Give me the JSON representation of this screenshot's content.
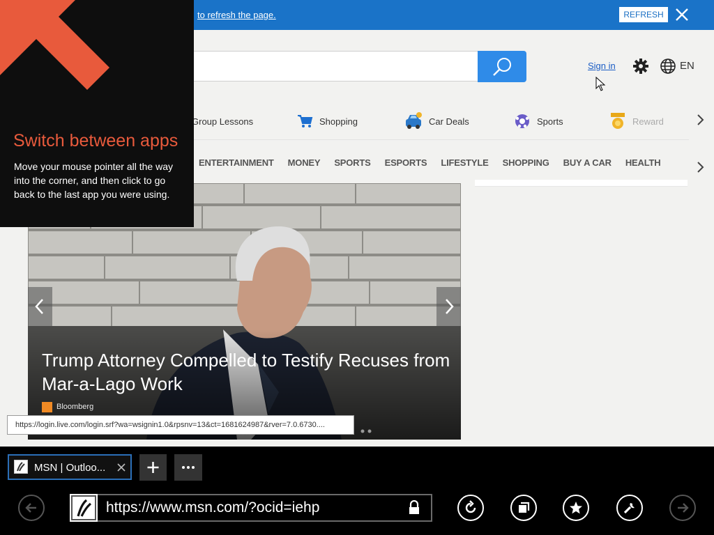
{
  "banner": {
    "text": "to refresh the page.",
    "refresh_label": "REFRESH"
  },
  "header": {
    "sign_in": "Sign in",
    "language": "EN"
  },
  "quick_links": [
    {
      "label": "Group Lessons",
      "icon": "none"
    },
    {
      "label": "Shopping",
      "icon": "shopping-cart-icon"
    },
    {
      "label": "Car Deals",
      "icon": "car-icon"
    },
    {
      "label": "Sports",
      "icon": "soccer-ball-icon"
    },
    {
      "label": "Reward",
      "icon": "medal-icon"
    }
  ],
  "categories": [
    "ENTERTAINMENT",
    "MONEY",
    "SPORTS",
    "ESPORTS",
    "LIFESTYLE",
    "SHOPPING",
    "BUY A CAR",
    "HEALTH"
  ],
  "hero": {
    "title": "Trump Attorney Compelled to Testify Recuses from Mar-a-Lago Work",
    "source": "Bloomberg"
  },
  "status_url": "https://login.live.com/login.srf?wa=wsignin1.0&rpsnv=13&ct=1681624987&rver=7.0.6730....",
  "overlay": {
    "title": "Switch between apps",
    "body": "Move your mouse pointer all the way into the corner, and then click to go back to the last app you were using."
  },
  "browser": {
    "tab_title": "MSN | Outloo...",
    "address": "https://www.msn.com/?ocid=iehp"
  },
  "colors": {
    "banner": "#1a73c8",
    "search_button": "#2f8be8",
    "overlay_accent": "#e85a3c",
    "tab_border": "#2b6fb8"
  }
}
